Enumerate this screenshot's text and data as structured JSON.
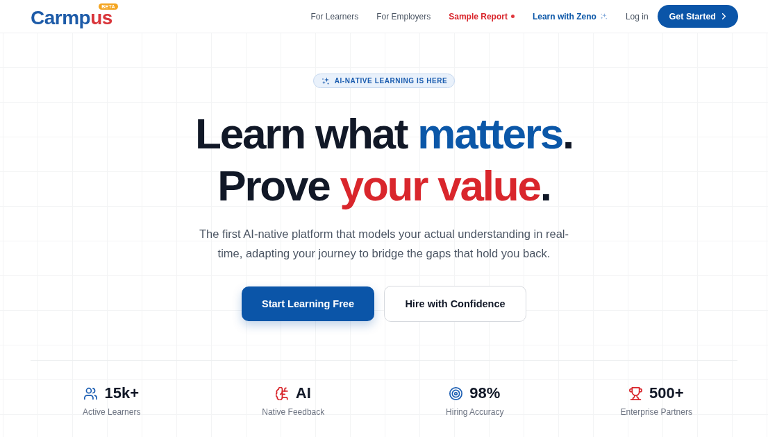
{
  "logo": {
    "parts": [
      {
        "text": "Carmp",
        "color": "#1d5ba8"
      },
      {
        "text": "us",
        "color": "#d9343a"
      }
    ],
    "badge": "BETA"
  },
  "nav": [
    {
      "label": "For Learners",
      "kind": "link"
    },
    {
      "label": "For Employers",
      "kind": "link"
    },
    {
      "label": "Sample Report",
      "kind": "report"
    },
    {
      "label": "Learn with Zeno",
      "kind": "zeno"
    },
    {
      "label": "Log in",
      "kind": "link"
    }
  ],
  "cta": {
    "label": "Get Started"
  },
  "hero": {
    "badge": "AI-NATIVE LEARNING IS HERE",
    "headline": [
      {
        "parts": [
          {
            "text": "Learn what "
          },
          {
            "text": "matters",
            "color": "#0b57a8"
          },
          {
            "text": "."
          }
        ]
      },
      {
        "parts": [
          {
            "text": "Prove "
          },
          {
            "text": "your value",
            "color": "#d9262c"
          },
          {
            "text": "."
          }
        ]
      }
    ],
    "subtitle": "The first AI-native platform that models your actual understanding in real-time, adapting your journey to bridge the gaps that hold you back.",
    "buttons": [
      {
        "label": "Start Learning Free",
        "kind": "primary"
      },
      {
        "label": "Hire with Confidence",
        "kind": "secondary"
      }
    ]
  },
  "stats": [
    {
      "value": "15k+",
      "label": "Active Learners"
    },
    {
      "value": "AI",
      "label": "Native Feedback"
    },
    {
      "value": "98%",
      "label": "Hiring Accuracy"
    },
    {
      "value": "500+",
      "label": "Enterprise Partners"
    }
  ]
}
